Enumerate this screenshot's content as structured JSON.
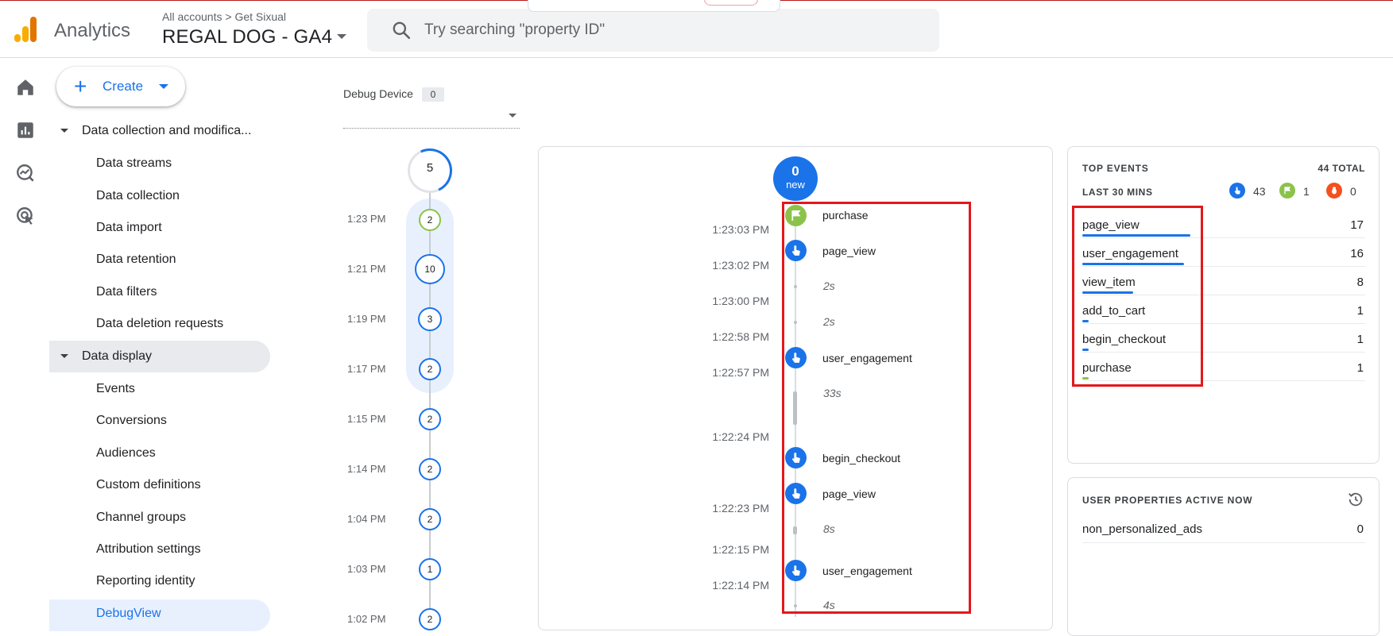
{
  "header": {
    "app_name": "Analytics",
    "breadcrumb": "All accounts > Get Sixual",
    "property": "REGAL DOG - GA4",
    "search_placeholder": "Try searching \"property ID\""
  },
  "nav": {
    "create_label": "Create",
    "sections": [
      {
        "label": "Data collection and modifica...",
        "items": [
          "Data streams",
          "Data collection",
          "Data import",
          "Data retention",
          "Data filters",
          "Data deletion requests"
        ]
      },
      {
        "label": "Data display",
        "items": [
          "Events",
          "Conversions",
          "Audiences",
          "Custom definitions",
          "Channel groups",
          "Attribution settings",
          "Reporting identity",
          "DebugView"
        ]
      }
    ]
  },
  "debug_device": {
    "label": "Debug Device",
    "count": "0"
  },
  "minutes_stream": {
    "total": "5",
    "entries": [
      {
        "time": "1:23 PM",
        "count": "2"
      },
      {
        "time": "1:21 PM",
        "count": "10"
      },
      {
        "time": "1:19 PM",
        "count": "3"
      },
      {
        "time": "1:17 PM",
        "count": "2"
      },
      {
        "time": "1:15 PM",
        "count": "2"
      },
      {
        "time": "1:14 PM",
        "count": "2"
      },
      {
        "time": "1:04 PM",
        "count": "2"
      },
      {
        "time": "1:03 PM",
        "count": "1"
      },
      {
        "time": "1:02 PM",
        "count": "2"
      }
    ]
  },
  "seconds_stream": {
    "new_count": "0",
    "new_label": "new",
    "times": [
      "1:23:03 PM",
      "1:23:02 PM",
      "1:23:00 PM",
      "1:22:58 PM",
      "1:22:57 PM",
      "1:22:24 PM",
      "1:22:23 PM",
      "1:22:15 PM",
      "1:22:14 PM"
    ],
    "events": [
      {
        "name": "purchase",
        "type": "conversion"
      },
      {
        "name": "page_view",
        "type": "event"
      },
      {
        "gap": "2s"
      },
      {
        "gap": "2s"
      },
      {
        "name": "user_engagement",
        "type": "event"
      },
      {
        "gap": "33s"
      },
      {
        "name": "begin_checkout",
        "type": "event"
      },
      {
        "name": "page_view",
        "type": "event"
      },
      {
        "gap": "8s"
      },
      {
        "name": "user_engagement",
        "type": "event"
      },
      {
        "gap": "4s"
      }
    ]
  },
  "top_events": {
    "title": "TOP EVENTS",
    "total": "44 TOTAL",
    "range": "LAST 30 MINS",
    "counts": {
      "events": "43",
      "conversions": "1",
      "errors": "0"
    },
    "rows": [
      {
        "name": "page_view",
        "value": "17",
        "share": 1.0,
        "color": "#1a73e8"
      },
      {
        "name": "user_engagement",
        "value": "16",
        "share": 0.94,
        "color": "#1a73e8"
      },
      {
        "name": "view_item",
        "value": "8",
        "share": 0.47,
        "color": "#1a73e8"
      },
      {
        "name": "add_to_cart",
        "value": "1",
        "share": 0.06,
        "color": "#1a73e8"
      },
      {
        "name": "begin_checkout",
        "value": "1",
        "share": 0.06,
        "color": "#1a73e8"
      },
      {
        "name": "purchase",
        "value": "1",
        "share": 0.06,
        "color": "#8bc34a"
      }
    ]
  },
  "user_properties": {
    "title": "USER PROPERTIES ACTIVE NOW",
    "rows": [
      {
        "name": "non_personalized_ads",
        "value": "0"
      }
    ]
  },
  "colors": {
    "accent": "#1a73e8",
    "conversion": "#8bc34a",
    "error": "#f4511e",
    "annotation": "#e3181b"
  }
}
